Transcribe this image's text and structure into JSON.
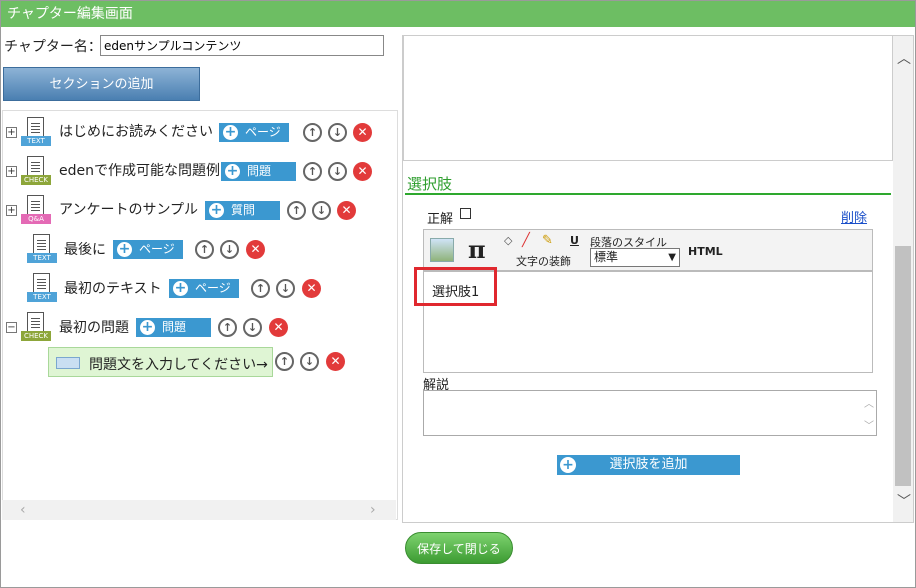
{
  "window": {
    "title": "チャプター編集画面"
  },
  "chapter": {
    "name_label": "チャプター名：",
    "name_value": "edenサンプルコンテンツ"
  },
  "buttons": {
    "add_section": "セクションの追加",
    "save_close": "保存して閉じる",
    "add_choice": "選択肢を追加"
  },
  "tree": {
    "nodes": [
      {
        "label": "はじめにお読みください",
        "type_tag": "TEXT",
        "action": "ページ",
        "expander": "+"
      },
      {
        "label": "edenで作成可能な問題例",
        "type_tag": "CHECK",
        "action": "問題",
        "expander": "+"
      },
      {
        "label": "アンケートのサンプル",
        "type_tag": "Q&A",
        "action": "質問",
        "expander": "+"
      },
      {
        "label": "最後に",
        "type_tag": "TEXT",
        "action": "ページ"
      },
      {
        "label": "最初のテキスト",
        "type_tag": "TEXT",
        "action": "ページ"
      },
      {
        "label": "最初の問題",
        "type_tag": "CHECK",
        "action": "問題",
        "expander": "−"
      }
    ],
    "question_item": "問題文を入力してください→"
  },
  "choices": {
    "section_title": "選択肢",
    "correct_label": "正解",
    "delete_link": "削除",
    "toolbar": {
      "decoration_label": "文字の装飾",
      "paragraph_label": "段落のスタイル",
      "paragraph_value": "標準",
      "html_label": "HTML",
      "pi": "π",
      "underline": "U"
    },
    "choice_text": "選択肢1",
    "explanation_label": "解説"
  },
  "icons": {
    "up": "up-arrow-icon",
    "down": "down-arrow-icon",
    "delete": "delete-icon",
    "plus": "plus-icon"
  },
  "colors": {
    "titlebar": "#6dbe63",
    "accent": "#3b98d0",
    "delete": "#e23a3a",
    "highlight": "#e0282e"
  }
}
